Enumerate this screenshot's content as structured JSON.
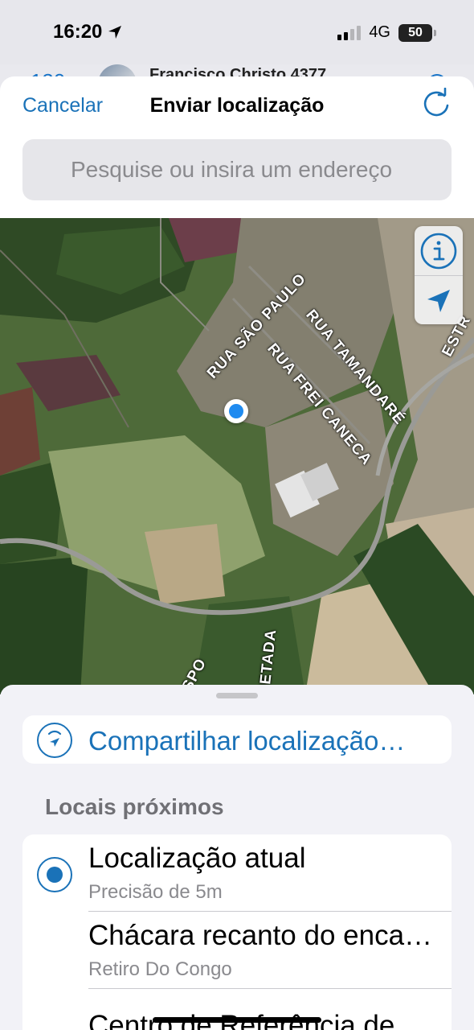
{
  "status_bar": {
    "time": "16:20",
    "network": "4G",
    "battery": "50"
  },
  "background_chat": {
    "back_label": "‹ 130",
    "contact_name": "Francisco Christo 4377"
  },
  "nav": {
    "cancel_label": "Cancelar",
    "title": "Enviar localização"
  },
  "search": {
    "placeholder": "Pesquise ou insira um endereço"
  },
  "map": {
    "streets": [
      {
        "label": "RUA SÃO PAULO"
      },
      {
        "label": "RUA TAMANDARÉ"
      },
      {
        "label": "RUA FREI CANECA"
      },
      {
        "label": "ESTR"
      },
      {
        "label": "JETADA"
      },
      {
        "label": "ESPO"
      }
    ],
    "controls": [
      "info-icon",
      "location-arrow-icon"
    ],
    "user_location_color": "#1f8bf0"
  },
  "share": {
    "label": "Compartilhar localização…"
  },
  "nearby": {
    "section_title": "Locais próximos",
    "items": [
      {
        "title": "Localização atual",
        "subtitle": "Precisão de 5m",
        "selected": true
      },
      {
        "title": "Chácara recanto do enca…",
        "subtitle": "Retiro Do Congo",
        "selected": false
      },
      {
        "title": "Centro de Referência de",
        "subtitle": "",
        "selected": false
      }
    ]
  },
  "colors": {
    "accent": "#1a72b8",
    "sheet_background": "#f2f2f7",
    "secondary_text": "#8a8a8e"
  }
}
